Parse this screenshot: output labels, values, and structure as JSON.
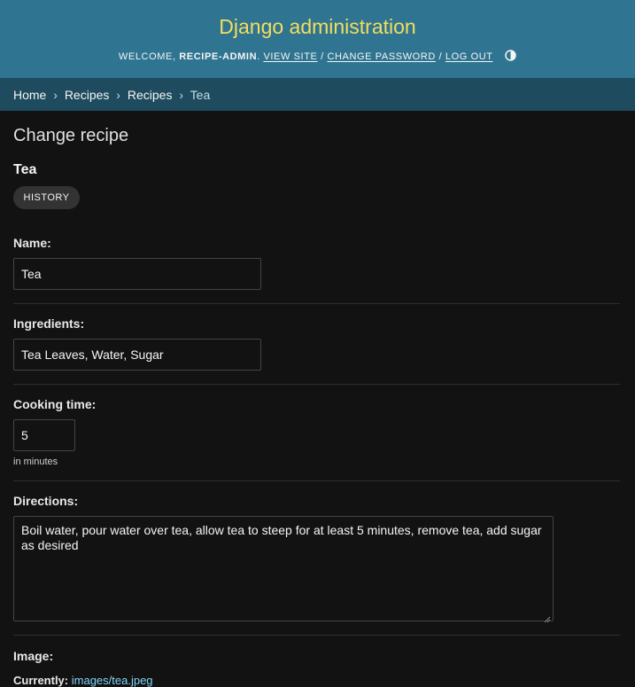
{
  "header": {
    "site_name": "Django administration",
    "welcome": "Welcome,",
    "username": "recipe-admin",
    "view_site": "View site",
    "change_password": "Change password",
    "log_out": "Log out",
    "separator": "/",
    "theme_toggle_icon": "contrast-icon"
  },
  "breadcrumbs": {
    "items": [
      "Home",
      "Recipes",
      "Recipes"
    ],
    "current": "Tea",
    "separator": "›"
  },
  "page": {
    "title": "Change recipe",
    "object_title": "Tea",
    "history_label": "History"
  },
  "form": {
    "name": {
      "label": "Name:",
      "value": "Tea"
    },
    "ingredients": {
      "label": "Ingredients:",
      "value": "Tea Leaves, Water, Sugar"
    },
    "cooking_time": {
      "label": "Cooking time:",
      "value": "5",
      "help": "in minutes"
    },
    "directions": {
      "label": "Directions:",
      "value": "Boil water, pour water over tea, allow tea to steep for at least 5 minutes, remove tea, add sugar as desired"
    },
    "image": {
      "label": "Image:",
      "currently_label": "Currently:",
      "current_file": "images/tea.jpeg"
    }
  },
  "colors": {
    "header_bg": "#2f7591",
    "site_name": "#f5dd5d",
    "breadcrumbs_bg": "#1e4b5e",
    "page_bg": "#121212",
    "link": "#81d4fa"
  }
}
